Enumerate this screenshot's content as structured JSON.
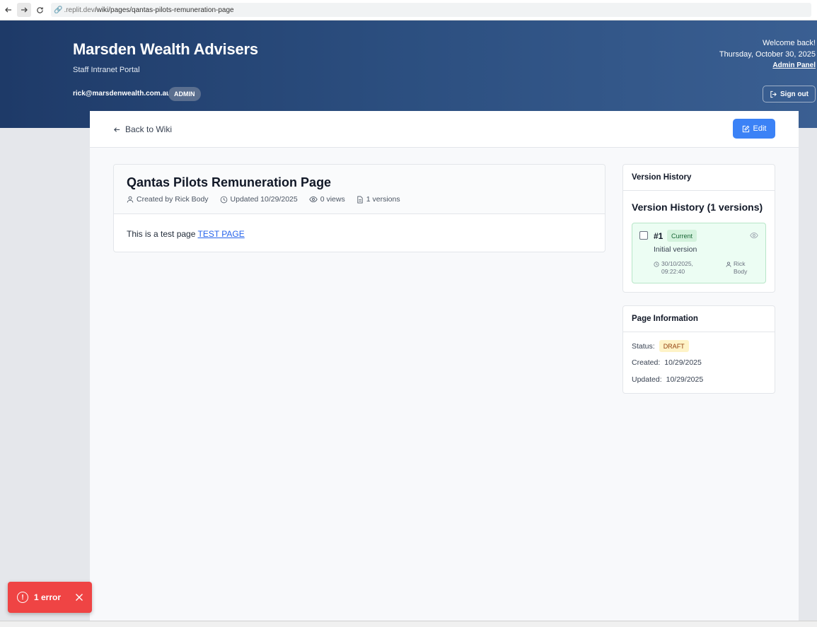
{
  "browser": {
    "url_prefix": ".replit.dev",
    "url_path": "/wiki/pages/qantas-pilots-remuneration-page"
  },
  "header": {
    "title": "Marsden Wealth Advisers",
    "subtitle": "Staff Intranet Portal",
    "user_email": "rick@marsdenwealth.com.au",
    "role": "ADMIN",
    "welcome": "Welcome back!",
    "date": "Thursday, October 30, 2025",
    "admin_link": "Admin Panel",
    "signout_label": "Sign out"
  },
  "toolbar": {
    "back_label": "Back to Wiki",
    "edit_label": "Edit"
  },
  "article": {
    "title": "Qantas Pilots Remuneration Page",
    "created_by": "Created by Rick Body",
    "updated": "Updated 10/29/2025",
    "views": "0 views",
    "versions": "1 versions",
    "body_text": "This is a test page ",
    "body_link": "TEST PAGE"
  },
  "version_history": {
    "card_title": "Version History",
    "heading": "Version History (1 versions)",
    "items": [
      {
        "number": "#1",
        "badge": "Current",
        "description": "Initial version",
        "date": "30/10/2025,",
        "time": "09:22:40",
        "author_first": "Rick",
        "author_last": "Body"
      }
    ]
  },
  "page_info": {
    "card_title": "Page Information",
    "status_label": "Status:",
    "status_value": "DRAFT",
    "created_label": "Created:",
    "created_value": "10/29/2025",
    "updated_label": "Updated:",
    "updated_value": "10/29/2025"
  },
  "error_toast": {
    "icon": "!",
    "label": "1 error"
  },
  "colors": {
    "header_start": "#1e3a68",
    "header_end": "#3a5f92",
    "primary": "#3b82f6",
    "error": "#ef4444",
    "current_bg": "#ecfdf3",
    "draft_bg": "#fef3c7"
  }
}
